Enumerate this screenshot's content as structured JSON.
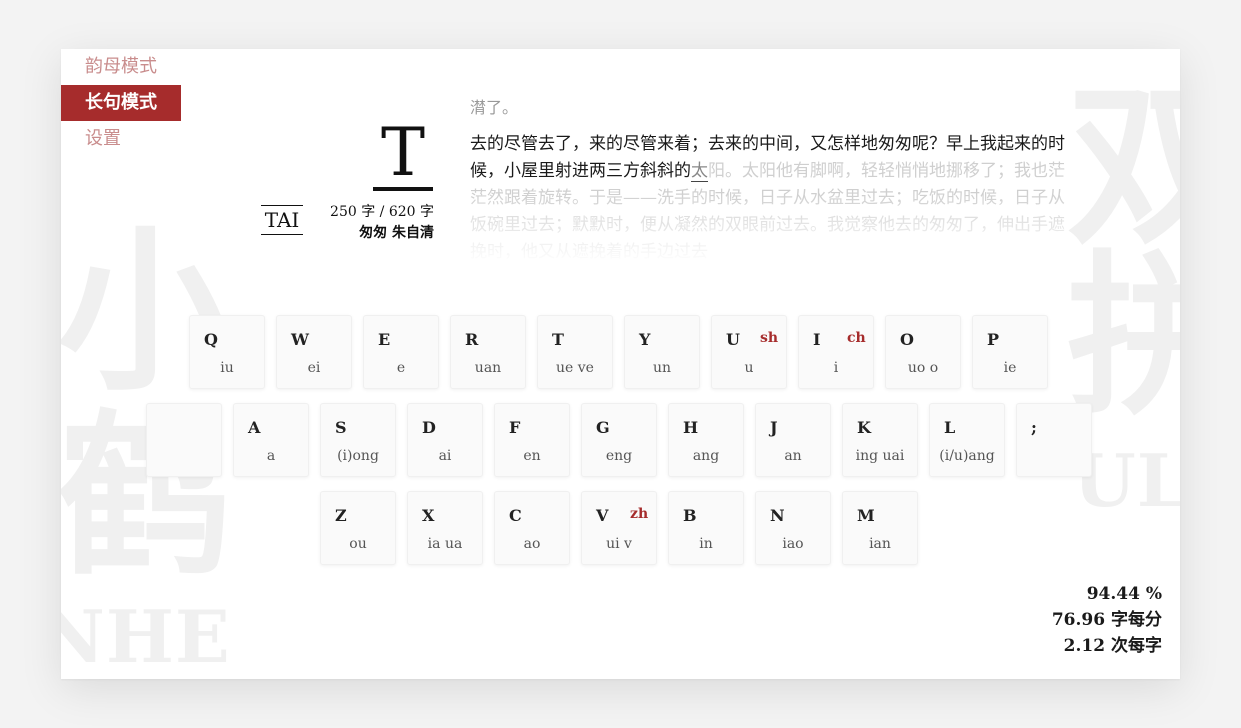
{
  "nav": {
    "items": [
      {
        "label": "韵母模式",
        "active": false
      },
      {
        "label": "长句模式",
        "active": true
      },
      {
        "label": "设置",
        "active": false
      }
    ]
  },
  "current": {
    "letter": "T",
    "pinyin": "TAI",
    "count": "250 字 / 620 字",
    "source": "匆匆 朱自清"
  },
  "text": {
    "prev_line": "潸了。",
    "typed": "去的尽管去了，来的尽管来着；去来的中间，又怎样地匆匆呢？早上我起来的时候，小屋里射进两三方斜斜的",
    "cursor_char": "太",
    "upcoming": "阳。太阳他有脚啊，轻轻悄悄地挪移了；我也茫茫然跟着旋转。于是——洗手的时候，日子从水盆里过去；吃饭的时候，日子从饭碗里过去；默默时，便从凝然的双眼前过去。我觉察他去的匆匆了，伸出手遮挽时，他又从遮挽着的手边过去"
  },
  "keyboard": {
    "row1": [
      {
        "key": "Q",
        "shengmu": "",
        "yunmu": "iu"
      },
      {
        "key": "W",
        "shengmu": "",
        "yunmu": "ei"
      },
      {
        "key": "E",
        "shengmu": "",
        "yunmu": "e"
      },
      {
        "key": "R",
        "shengmu": "",
        "yunmu": "uan"
      },
      {
        "key": "T",
        "shengmu": "",
        "yunmu": "ue ve"
      },
      {
        "key": "Y",
        "shengmu": "",
        "yunmu": "un"
      },
      {
        "key": "U",
        "shengmu": "sh",
        "yunmu": "u"
      },
      {
        "key": "I",
        "shengmu": "ch",
        "yunmu": "i"
      },
      {
        "key": "O",
        "shengmu": "",
        "yunmu": "uo o"
      },
      {
        "key": "P",
        "shengmu": "",
        "yunmu": "ie"
      }
    ],
    "row2": [
      {
        "key": "",
        "shengmu": "",
        "yunmu": ""
      },
      {
        "key": "A",
        "shengmu": "",
        "yunmu": "a"
      },
      {
        "key": "S",
        "shengmu": "",
        "yunmu": "(i)ong"
      },
      {
        "key": "D",
        "shengmu": "",
        "yunmu": "ai"
      },
      {
        "key": "F",
        "shengmu": "",
        "yunmu": "en"
      },
      {
        "key": "G",
        "shengmu": "",
        "yunmu": "eng"
      },
      {
        "key": "H",
        "shengmu": "",
        "yunmu": "ang"
      },
      {
        "key": "J",
        "shengmu": "",
        "yunmu": "an"
      },
      {
        "key": "K",
        "shengmu": "",
        "yunmu": "ing uai"
      },
      {
        "key": "L",
        "shengmu": "",
        "yunmu": "(i/u)ang"
      },
      {
        "key": ";",
        "shengmu": "",
        "yunmu": ""
      }
    ],
    "row3": [
      {
        "key": "Z",
        "shengmu": "",
        "yunmu": "ou"
      },
      {
        "key": "X",
        "shengmu": "",
        "yunmu": "ia ua"
      },
      {
        "key": "C",
        "shengmu": "",
        "yunmu": "ao"
      },
      {
        "key": "V",
        "shengmu": "zh",
        "yunmu": "ui v"
      },
      {
        "key": "B",
        "shengmu": "",
        "yunmu": "in"
      },
      {
        "key": "N",
        "shengmu": "",
        "yunmu": "iao"
      },
      {
        "key": "M",
        "shengmu": "",
        "yunmu": "ian"
      }
    ]
  },
  "stats": {
    "accuracy": "94.44 %",
    "speed": "76.96 字每分",
    "keystrokes": "2.12 次每字"
  },
  "background": {
    "left_chars": [
      "小",
      "鹤"
    ],
    "left_latin": "NHE",
    "right_chars": [
      "双",
      "拼"
    ],
    "right_latin": "ULI"
  },
  "colors": {
    "accent": "#a62c2c",
    "menu_inactive": "#c98d8d"
  }
}
